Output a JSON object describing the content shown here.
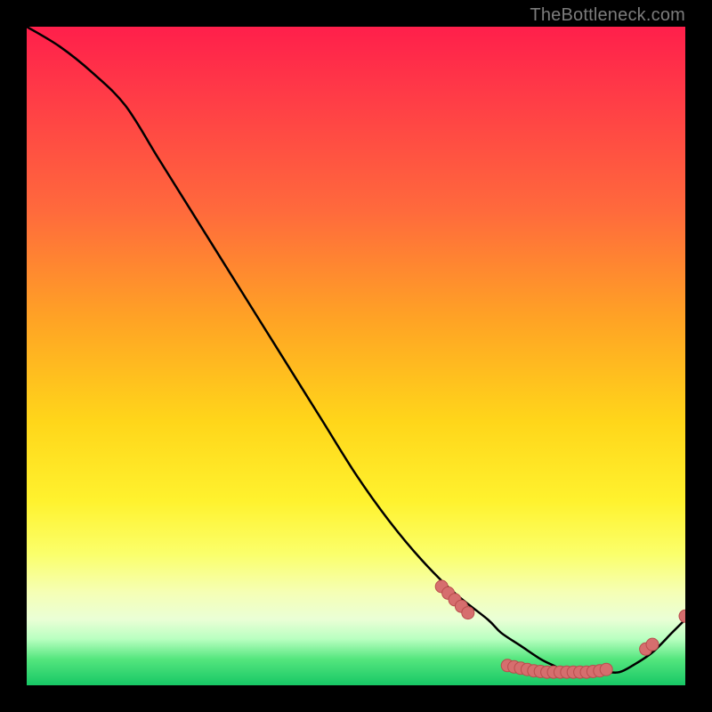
{
  "attribution": "TheBottleneck.com",
  "colors": {
    "marker_fill": "#d66e6e",
    "marker_stroke": "#b94d4d",
    "curve_stroke": "#000000"
  },
  "chart_data": {
    "type": "line",
    "title": "",
    "xlabel": "",
    "ylabel": "",
    "xlim": [
      0,
      100
    ],
    "ylim": [
      0,
      100
    ],
    "grid": false,
    "legend": false,
    "series": [
      {
        "name": "curve",
        "x": [
          0,
          5,
          10,
          15,
          20,
          25,
          30,
          35,
          40,
          45,
          50,
          55,
          60,
          65,
          70,
          72,
          75,
          78,
          80,
          82,
          85,
          88,
          90,
          92,
          95,
          98,
          100
        ],
        "y": [
          100,
          97,
          93,
          88,
          80,
          72,
          64,
          56,
          48,
          40,
          32,
          25,
          19,
          14,
          10,
          8,
          6,
          4,
          3,
          2,
          2,
          2,
          2,
          3,
          5,
          8,
          10
        ]
      }
    ],
    "markers": [
      {
        "x": 63,
        "y": 15
      },
      {
        "x": 64,
        "y": 14
      },
      {
        "x": 65,
        "y": 13
      },
      {
        "x": 66,
        "y": 12
      },
      {
        "x": 67,
        "y": 11
      },
      {
        "x": 73,
        "y": 3.0
      },
      {
        "x": 74,
        "y": 2.8
      },
      {
        "x": 75,
        "y": 2.6
      },
      {
        "x": 76,
        "y": 2.4
      },
      {
        "x": 77,
        "y": 2.2
      },
      {
        "x": 78,
        "y": 2.1
      },
      {
        "x": 79,
        "y": 2.0
      },
      {
        "x": 80,
        "y": 2.0
      },
      {
        "x": 81,
        "y": 2.0
      },
      {
        "x": 82,
        "y": 2.0
      },
      {
        "x": 83,
        "y": 2.0
      },
      {
        "x": 84,
        "y": 2.0
      },
      {
        "x": 85,
        "y": 2.0
      },
      {
        "x": 86,
        "y": 2.1
      },
      {
        "x": 87,
        "y": 2.2
      },
      {
        "x": 88,
        "y": 2.4
      },
      {
        "x": 94,
        "y": 5.5
      },
      {
        "x": 95,
        "y": 6.2
      },
      {
        "x": 100,
        "y": 10.5
      }
    ]
  }
}
